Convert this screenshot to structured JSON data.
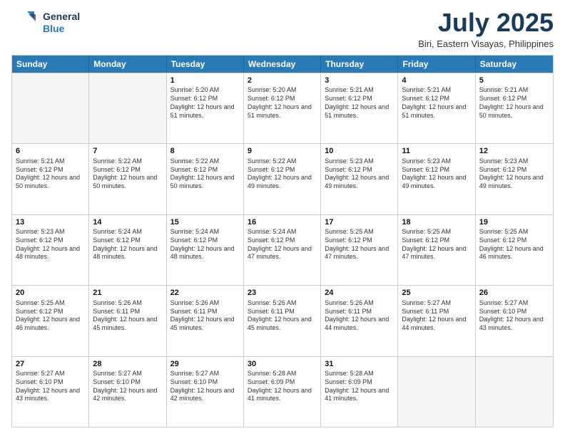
{
  "header": {
    "logo_line1": "General",
    "logo_line2": "Blue",
    "month": "July 2025",
    "location": "Biri, Eastern Visayas, Philippines"
  },
  "weekdays": [
    "Sunday",
    "Monday",
    "Tuesday",
    "Wednesday",
    "Thursday",
    "Friday",
    "Saturday"
  ],
  "rows": [
    [
      {
        "day": "",
        "info": ""
      },
      {
        "day": "",
        "info": ""
      },
      {
        "day": "1",
        "info": "Sunrise: 5:20 AM\nSunset: 6:12 PM\nDaylight: 12 hours and 51 minutes."
      },
      {
        "day": "2",
        "info": "Sunrise: 5:20 AM\nSunset: 6:12 PM\nDaylight: 12 hours and 51 minutes."
      },
      {
        "day": "3",
        "info": "Sunrise: 5:21 AM\nSunset: 6:12 PM\nDaylight: 12 hours and 51 minutes."
      },
      {
        "day": "4",
        "info": "Sunrise: 5:21 AM\nSunset: 6:12 PM\nDaylight: 12 hours and 51 minutes."
      },
      {
        "day": "5",
        "info": "Sunrise: 5:21 AM\nSunset: 6:12 PM\nDaylight: 12 hours and 50 minutes."
      }
    ],
    [
      {
        "day": "6",
        "info": "Sunrise: 5:21 AM\nSunset: 6:12 PM\nDaylight: 12 hours and 50 minutes."
      },
      {
        "day": "7",
        "info": "Sunrise: 5:22 AM\nSunset: 6:12 PM\nDaylight: 12 hours and 50 minutes."
      },
      {
        "day": "8",
        "info": "Sunrise: 5:22 AM\nSunset: 6:12 PM\nDaylight: 12 hours and 50 minutes."
      },
      {
        "day": "9",
        "info": "Sunrise: 5:22 AM\nSunset: 6:12 PM\nDaylight: 12 hours and 49 minutes."
      },
      {
        "day": "10",
        "info": "Sunrise: 5:23 AM\nSunset: 6:12 PM\nDaylight: 12 hours and 49 minutes."
      },
      {
        "day": "11",
        "info": "Sunrise: 5:23 AM\nSunset: 6:12 PM\nDaylight: 12 hours and 49 minutes."
      },
      {
        "day": "12",
        "info": "Sunrise: 5:23 AM\nSunset: 6:12 PM\nDaylight: 12 hours and 49 minutes."
      }
    ],
    [
      {
        "day": "13",
        "info": "Sunrise: 5:23 AM\nSunset: 6:12 PM\nDaylight: 12 hours and 48 minutes."
      },
      {
        "day": "14",
        "info": "Sunrise: 5:24 AM\nSunset: 6:12 PM\nDaylight: 12 hours and 48 minutes."
      },
      {
        "day": "15",
        "info": "Sunrise: 5:24 AM\nSunset: 6:12 PM\nDaylight: 12 hours and 48 minutes."
      },
      {
        "day": "16",
        "info": "Sunrise: 5:24 AM\nSunset: 6:12 PM\nDaylight: 12 hours and 47 minutes."
      },
      {
        "day": "17",
        "info": "Sunrise: 5:25 AM\nSunset: 6:12 PM\nDaylight: 12 hours and 47 minutes."
      },
      {
        "day": "18",
        "info": "Sunrise: 5:25 AM\nSunset: 6:12 PM\nDaylight: 12 hours and 47 minutes."
      },
      {
        "day": "19",
        "info": "Sunrise: 5:25 AM\nSunset: 6:12 PM\nDaylight: 12 hours and 46 minutes."
      }
    ],
    [
      {
        "day": "20",
        "info": "Sunrise: 5:25 AM\nSunset: 6:12 PM\nDaylight: 12 hours and 46 minutes."
      },
      {
        "day": "21",
        "info": "Sunrise: 5:26 AM\nSunset: 6:11 PM\nDaylight: 12 hours and 45 minutes."
      },
      {
        "day": "22",
        "info": "Sunrise: 5:26 AM\nSunset: 6:11 PM\nDaylight: 12 hours and 45 minutes."
      },
      {
        "day": "23",
        "info": "Sunrise: 5:26 AM\nSunset: 6:11 PM\nDaylight: 12 hours and 45 minutes."
      },
      {
        "day": "24",
        "info": "Sunrise: 5:26 AM\nSunset: 6:11 PM\nDaylight: 12 hours and 44 minutes."
      },
      {
        "day": "25",
        "info": "Sunrise: 5:27 AM\nSunset: 6:11 PM\nDaylight: 12 hours and 44 minutes."
      },
      {
        "day": "26",
        "info": "Sunrise: 5:27 AM\nSunset: 6:10 PM\nDaylight: 12 hours and 43 minutes."
      }
    ],
    [
      {
        "day": "27",
        "info": "Sunrise: 5:27 AM\nSunset: 6:10 PM\nDaylight: 12 hours and 43 minutes."
      },
      {
        "day": "28",
        "info": "Sunrise: 5:27 AM\nSunset: 6:10 PM\nDaylight: 12 hours and 42 minutes."
      },
      {
        "day": "29",
        "info": "Sunrise: 5:27 AM\nSunset: 6:10 PM\nDaylight: 12 hours and 42 minutes."
      },
      {
        "day": "30",
        "info": "Sunrise: 5:28 AM\nSunset: 6:09 PM\nDaylight: 12 hours and 41 minutes."
      },
      {
        "day": "31",
        "info": "Sunrise: 5:28 AM\nSunset: 6:09 PM\nDaylight: 12 hours and 41 minutes."
      },
      {
        "day": "",
        "info": ""
      },
      {
        "day": "",
        "info": ""
      }
    ]
  ]
}
